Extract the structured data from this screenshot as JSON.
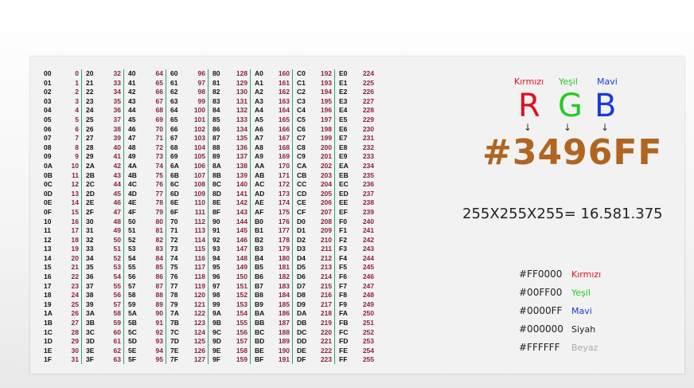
{
  "table": [
    [
      [
        "00",
        "0"
      ],
      [
        "01",
        "1"
      ],
      [
        "02",
        "2"
      ],
      [
        "03",
        "3"
      ],
      [
        "04",
        "4"
      ],
      [
        "05",
        "5"
      ],
      [
        "06",
        "6"
      ],
      [
        "07",
        "7"
      ],
      [
        "08",
        "8"
      ],
      [
        "09",
        "9"
      ],
      [
        "0A",
        "10"
      ],
      [
        "0B",
        "11"
      ],
      [
        "0C",
        "12"
      ],
      [
        "0D",
        "13"
      ],
      [
        "0E",
        "14"
      ],
      [
        "0F",
        "15"
      ],
      [
        "10",
        "16"
      ],
      [
        "11",
        "17"
      ],
      [
        "12",
        "18"
      ],
      [
        "13",
        "19"
      ],
      [
        "14",
        "20"
      ],
      [
        "15",
        "21"
      ],
      [
        "16",
        "22"
      ],
      [
        "17",
        "23"
      ],
      [
        "18",
        "24"
      ],
      [
        "19",
        "25"
      ],
      [
        "1A",
        "26"
      ],
      [
        "1B",
        "27"
      ],
      [
        "1C",
        "28"
      ],
      [
        "1D",
        "29"
      ],
      [
        "1E",
        "30"
      ],
      [
        "1F",
        "31"
      ]
    ],
    [
      [
        "20",
        "32"
      ],
      [
        "21",
        "33"
      ],
      [
        "22",
        "34"
      ],
      [
        "23",
        "35"
      ],
      [
        "24",
        "36"
      ],
      [
        "25",
        "37"
      ],
      [
        "26",
        "38"
      ],
      [
        "27",
        "39"
      ],
      [
        "28",
        "40"
      ],
      [
        "29",
        "41"
      ],
      [
        "2A",
        "42"
      ],
      [
        "2B",
        "43"
      ],
      [
        "2C",
        "44"
      ],
      [
        "2D",
        "45"
      ],
      [
        "2E",
        "46"
      ],
      [
        "2F",
        "47"
      ],
      [
        "30",
        "48"
      ],
      [
        "31",
        "49"
      ],
      [
        "32",
        "50"
      ],
      [
        "33",
        "51"
      ],
      [
        "34",
        "52"
      ],
      [
        "35",
        "53"
      ],
      [
        "36",
        "54"
      ],
      [
        "37",
        "55"
      ],
      [
        "38",
        "56"
      ],
      [
        "39",
        "57"
      ],
      [
        "3A",
        "58"
      ],
      [
        "3B",
        "59"
      ],
      [
        "3C",
        "60"
      ],
      [
        "3D",
        "61"
      ],
      [
        "3E",
        "62"
      ],
      [
        "3F",
        "63"
      ]
    ],
    [
      [
        "40",
        "64"
      ],
      [
        "41",
        "65"
      ],
      [
        "42",
        "66"
      ],
      [
        "43",
        "67"
      ],
      [
        "44",
        "68"
      ],
      [
        "45",
        "69"
      ],
      [
        "46",
        "70"
      ],
      [
        "47",
        "71"
      ],
      [
        "48",
        "72"
      ],
      [
        "49",
        "73"
      ],
      [
        "4A",
        "74"
      ],
      [
        "4B",
        "75"
      ],
      [
        "4C",
        "76"
      ],
      [
        "4D",
        "77"
      ],
      [
        "4E",
        "78"
      ],
      [
        "4F",
        "79"
      ],
      [
        "50",
        "80"
      ],
      [
        "51",
        "81"
      ],
      [
        "52",
        "82"
      ],
      [
        "53",
        "83"
      ],
      [
        "54",
        "84"
      ],
      [
        "55",
        "85"
      ],
      [
        "56",
        "86"
      ],
      [
        "57",
        "87"
      ],
      [
        "58",
        "88"
      ],
      [
        "59",
        "89"
      ],
      [
        "5A",
        "90"
      ],
      [
        "5B",
        "91"
      ],
      [
        "5C",
        "92"
      ],
      [
        "5D",
        "93"
      ],
      [
        "5E",
        "94"
      ],
      [
        "5F",
        "95"
      ]
    ],
    [
      [
        "60",
        "96"
      ],
      [
        "61",
        "97"
      ],
      [
        "62",
        "98"
      ],
      [
        "63",
        "99"
      ],
      [
        "64",
        "100"
      ],
      [
        "65",
        "101"
      ],
      [
        "66",
        "102"
      ],
      [
        "67",
        "103"
      ],
      [
        "68",
        "104"
      ],
      [
        "69",
        "105"
      ],
      [
        "6A",
        "106"
      ],
      [
        "6B",
        "107"
      ],
      [
        "6C",
        "108"
      ],
      [
        "6D",
        "109"
      ],
      [
        "6E",
        "110"
      ],
      [
        "6F",
        "111"
      ],
      [
        "70",
        "112"
      ],
      [
        "71",
        "113"
      ],
      [
        "72",
        "114"
      ],
      [
        "73",
        "115"
      ],
      [
        "74",
        "116"
      ],
      [
        "75",
        "117"
      ],
      [
        "76",
        "118"
      ],
      [
        "77",
        "119"
      ],
      [
        "78",
        "120"
      ],
      [
        "79",
        "121"
      ],
      [
        "7A",
        "122"
      ],
      [
        "7B",
        "123"
      ],
      [
        "7C",
        "124"
      ],
      [
        "7D",
        "125"
      ],
      [
        "7E",
        "126"
      ],
      [
        "7F",
        "127"
      ]
    ],
    [
      [
        "80",
        "128"
      ],
      [
        "81",
        "129"
      ],
      [
        "82",
        "130"
      ],
      [
        "83",
        "131"
      ],
      [
        "84",
        "132"
      ],
      [
        "85",
        "133"
      ],
      [
        "86",
        "134"
      ],
      [
        "87",
        "135"
      ],
      [
        "88",
        "136"
      ],
      [
        "89",
        "137"
      ],
      [
        "8A",
        "138"
      ],
      [
        "8B",
        "139"
      ],
      [
        "8C",
        "140"
      ],
      [
        "8D",
        "141"
      ],
      [
        "8E",
        "142"
      ],
      [
        "8F",
        "143"
      ],
      [
        "90",
        "144"
      ],
      [
        "91",
        "145"
      ],
      [
        "92",
        "146"
      ],
      [
        "93",
        "147"
      ],
      [
        "94",
        "148"
      ],
      [
        "95",
        "149"
      ],
      [
        "96",
        "150"
      ],
      [
        "97",
        "151"
      ],
      [
        "98",
        "152"
      ],
      [
        "99",
        "153"
      ],
      [
        "9A",
        "154"
      ],
      [
        "9B",
        "155"
      ],
      [
        "9C",
        "156"
      ],
      [
        "9D",
        "157"
      ],
      [
        "9E",
        "158"
      ],
      [
        "9F",
        "159"
      ]
    ],
    [
      [
        "A0",
        "160"
      ],
      [
        "A1",
        "161"
      ],
      [
        "A2",
        "162"
      ],
      [
        "A3",
        "163"
      ],
      [
        "A4",
        "164"
      ],
      [
        "A5",
        "165"
      ],
      [
        "A6",
        "166"
      ],
      [
        "A7",
        "167"
      ],
      [
        "A8",
        "168"
      ],
      [
        "A9",
        "169"
      ],
      [
        "AA",
        "170"
      ],
      [
        "AB",
        "171"
      ],
      [
        "AC",
        "172"
      ],
      [
        "AD",
        "173"
      ],
      [
        "AE",
        "174"
      ],
      [
        "AF",
        "175"
      ],
      [
        "B0",
        "176"
      ],
      [
        "B1",
        "177"
      ],
      [
        "B2",
        "178"
      ],
      [
        "B3",
        "179"
      ],
      [
        "B4",
        "180"
      ],
      [
        "B5",
        "181"
      ],
      [
        "B6",
        "182"
      ],
      [
        "B7",
        "183"
      ],
      [
        "B8",
        "184"
      ],
      [
        "B9",
        "185"
      ],
      [
        "BA",
        "186"
      ],
      [
        "BB",
        "187"
      ],
      [
        "BC",
        "188"
      ],
      [
        "BD",
        "189"
      ],
      [
        "BE",
        "190"
      ],
      [
        "BF",
        "191"
      ]
    ],
    [
      [
        "C0",
        "192"
      ],
      [
        "C1",
        "193"
      ],
      [
        "C2",
        "194"
      ],
      [
        "C3",
        "195"
      ],
      [
        "C4",
        "196"
      ],
      [
        "C5",
        "197"
      ],
      [
        "C6",
        "198"
      ],
      [
        "C7",
        "199"
      ],
      [
        "C8",
        "200"
      ],
      [
        "C9",
        "201"
      ],
      [
        "CA",
        "202"
      ],
      [
        "CB",
        "203"
      ],
      [
        "CC",
        "204"
      ],
      [
        "CD",
        "205"
      ],
      [
        "CE",
        "206"
      ],
      [
        "CF",
        "207"
      ],
      [
        "D0",
        "208"
      ],
      [
        "D1",
        "209"
      ],
      [
        "D2",
        "210"
      ],
      [
        "D3",
        "211"
      ],
      [
        "D4",
        "212"
      ],
      [
        "D5",
        "213"
      ],
      [
        "D6",
        "214"
      ],
      [
        "D7",
        "215"
      ],
      [
        "D8",
        "216"
      ],
      [
        "D9",
        "217"
      ],
      [
        "DA",
        "218"
      ],
      [
        "DB",
        "219"
      ],
      [
        "DC",
        "220"
      ],
      [
        "DD",
        "221"
      ],
      [
        "DE",
        "222"
      ],
      [
        "DF",
        "223"
      ]
    ],
    [
      [
        "E0",
        "224"
      ],
      [
        "E1",
        "225"
      ],
      [
        "E2",
        "226"
      ],
      [
        "E3",
        "227"
      ],
      [
        "E4",
        "228"
      ],
      [
        "E5",
        "229"
      ],
      [
        "E6",
        "230"
      ],
      [
        "E7",
        "231"
      ],
      [
        "E8",
        "232"
      ],
      [
        "E9",
        "233"
      ],
      [
        "EA",
        "234"
      ],
      [
        "EB",
        "235"
      ],
      [
        "EC",
        "236"
      ],
      [
        "ED",
        "237"
      ],
      [
        "EE",
        "238"
      ],
      [
        "EF",
        "239"
      ],
      [
        "F0",
        "240"
      ],
      [
        "F1",
        "241"
      ],
      [
        "F2",
        "242"
      ],
      [
        "F3",
        "243"
      ],
      [
        "F4",
        "244"
      ],
      [
        "F5",
        "245"
      ],
      [
        "F6",
        "246"
      ],
      [
        "F7",
        "247"
      ],
      [
        "F8",
        "248"
      ],
      [
        "F9",
        "249"
      ],
      [
        "FA",
        "250"
      ],
      [
        "FB",
        "251"
      ],
      [
        "FC",
        "252"
      ],
      [
        "FD",
        "253"
      ],
      [
        "FE",
        "254"
      ],
      [
        "FF",
        "255"
      ]
    ]
  ],
  "rgb": {
    "red": {
      "name": "Kırmızı",
      "letter": "R",
      "color": "#e01020"
    },
    "green": {
      "name": "Yeşil",
      "letter": "G",
      "color": "#22cc22"
    },
    "blue": {
      "name": "Mavi",
      "letter": "B",
      "color": "#1a3ad8"
    },
    "arrow": "↓"
  },
  "big_hex": "#3496FF",
  "big_hex_color": "#b06520",
  "formula": "255X255X255= 16.581.375",
  "legend": [
    {
      "code": "#FF0000",
      "name": "Kırmızı",
      "color": "#e01020"
    },
    {
      "code": "#00FF00",
      "name": "Yeşil",
      "color": "#22cc22"
    },
    {
      "code": "#0000FF",
      "name": "Mavi",
      "color": "#1a3ad8"
    },
    {
      "code": "#000000",
      "name": "Siyah",
      "color": "#222222"
    },
    {
      "code": "#FFFFFF",
      "name": "Beyaz",
      "color": "#aaaaaa"
    }
  ]
}
